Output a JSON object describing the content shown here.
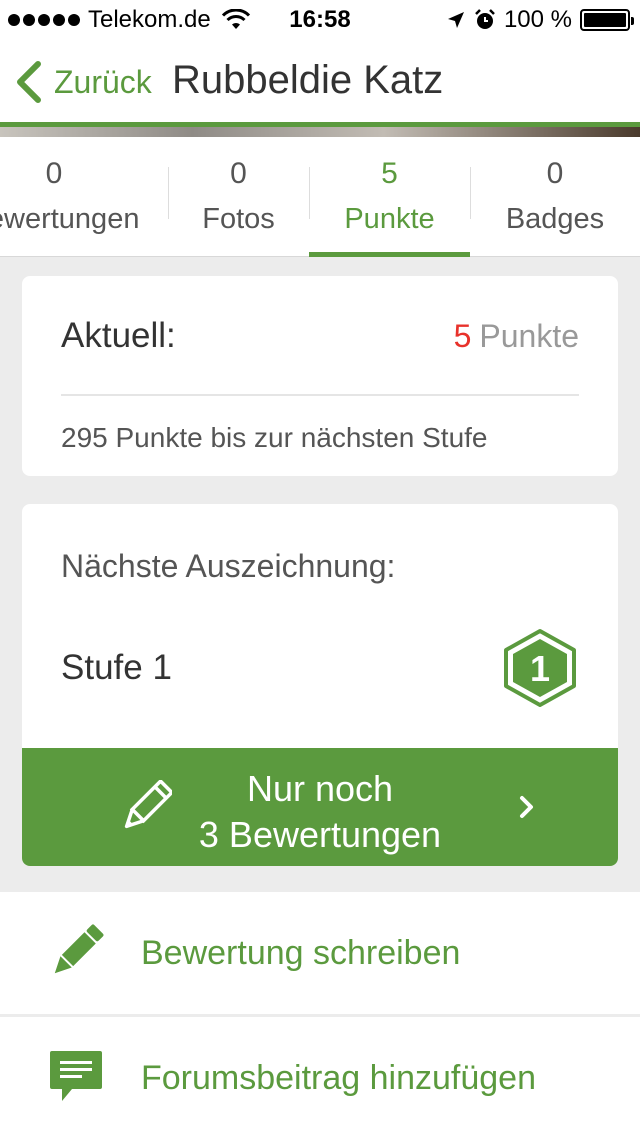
{
  "status_bar": {
    "carrier": "Telekom.de",
    "time": "16:58",
    "battery": "100 %",
    "icons": [
      "signal-dots-icon",
      "wifi-icon",
      "location-arrow-icon",
      "alarm-icon",
      "battery-icon"
    ]
  },
  "nav": {
    "back_label": "Zurück",
    "title": "Rubbeldie Katz"
  },
  "tabs": [
    {
      "count": "0",
      "label": "Bewertungen",
      "active": false
    },
    {
      "count": "0",
      "label": "Fotos",
      "active": false
    },
    {
      "count": "5",
      "label": "Punkte",
      "active": true
    },
    {
      "count": "0",
      "label": "Badges",
      "active": false
    }
  ],
  "current": {
    "label": "Aktuell:",
    "points_value": "5",
    "points_unit": "Punkte",
    "progress_text": "295 Punkte bis zur nächsten Stufe"
  },
  "next_award": {
    "label": "Nächste Auszeichnung:",
    "level_name": "Stufe 1",
    "badge_number": "1",
    "cta_line1": "Nur noch",
    "cta_line2": "3 Bewertungen"
  },
  "actions": [
    {
      "label": "Bewertung schreiben",
      "icon": "pencil-icon"
    },
    {
      "label": "Forumsbeitrag hinzufügen",
      "icon": "comment-icon"
    }
  ],
  "colors": {
    "accent": "#5b9a3e",
    "points_highlight": "#e8322b",
    "background": "#ececec"
  }
}
